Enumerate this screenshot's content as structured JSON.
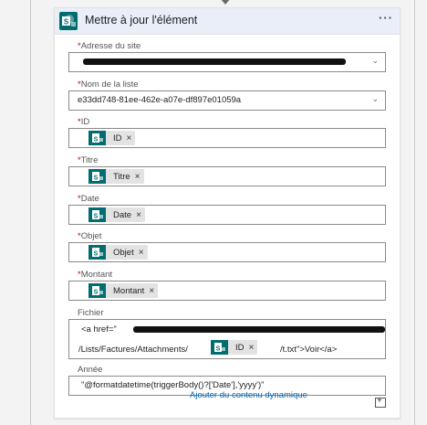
{
  "action": {
    "title": "Mettre à jour l'élément",
    "more_label": "···"
  },
  "fields": [
    {
      "key": "site",
      "label": "Adresse du site",
      "required": "*",
      "value": "https://.........sharepoint.com/sites/FormationSharepoint...",
      "redacted": true
    },
    {
      "key": "list",
      "label": "Nom de la liste",
      "required": "*",
      "value": "e33dd748-81ee-462e-a07e-df897e01059a"
    },
    {
      "key": "id",
      "label": "ID",
      "required": "*",
      "token": "ID"
    },
    {
      "key": "titre",
      "label": "Titre",
      "required": "*",
      "token": "Titre"
    },
    {
      "key": "date",
      "label": "Date",
      "required": "*",
      "token": "Date"
    },
    {
      "key": "objet",
      "label": "Objet",
      "required": "*",
      "token": "Objet"
    },
    {
      "key": "montant",
      "label": "Montant",
      "required": "*",
      "token": "Montant"
    }
  ],
  "fichier": {
    "label": "Fichier",
    "line1_prefix": "<a href=\"",
    "line2_prefix": "/Lists/Factures/Attachments/",
    "token": "ID",
    "line2_suffix": "/t.txt\">Voir</a>"
  },
  "annee": {
    "label": "Année",
    "value": "\"@formatdatetime(triggerBody()?['Date'],'yyyy')\""
  },
  "dynamic_link": "Ajouter du contenu dynamique",
  "icons": {
    "sharepoint": "sharepoint-icon",
    "chevron": "chevron-down-icon",
    "remove": "remove-token-icon"
  },
  "colors": {
    "sharepoint": "#036c70",
    "header": "#e9eef8",
    "required": "#c8000b",
    "link": "#0063b1"
  }
}
